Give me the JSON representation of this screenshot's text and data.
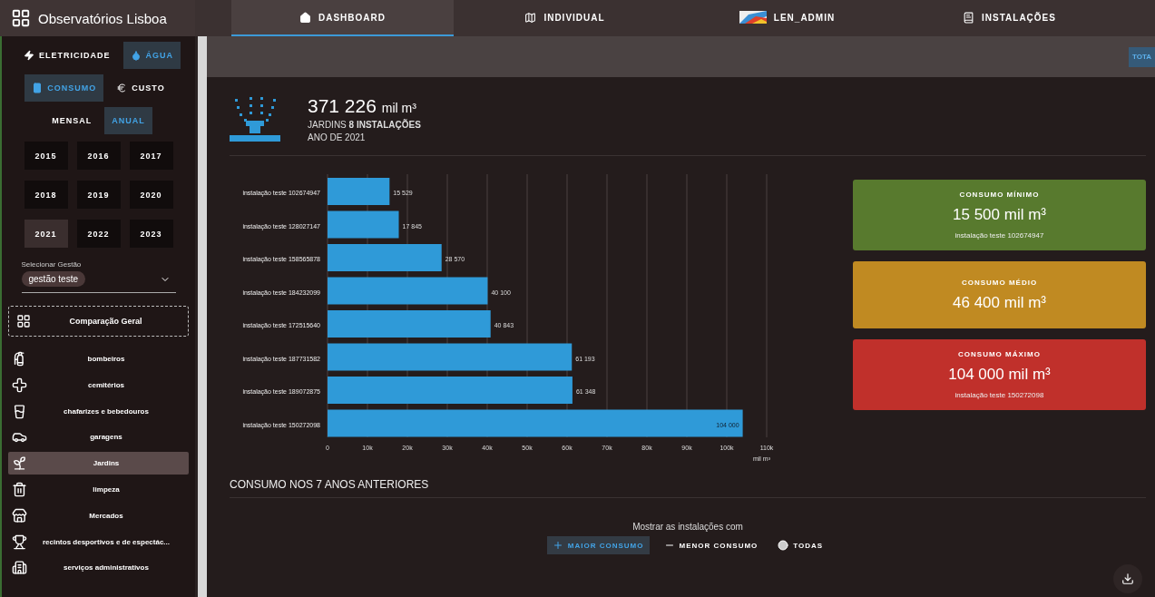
{
  "app": {
    "title": "Observatórios Lisboa"
  },
  "tabs": [
    {
      "label": "DASHBOARD",
      "selected": true
    },
    {
      "label": "INDIVIDUAL",
      "selected": false
    },
    {
      "label": "LEN_ADMIN",
      "selected": false
    },
    {
      "label": "INSTALAÇÕES",
      "selected": false
    }
  ],
  "toolbar": {
    "button": "TOTA"
  },
  "sidebar": {
    "toggles": [
      [
        {
          "label": "ELETRICIDADE",
          "selected": false
        },
        {
          "label": "ÁGUA",
          "selected": true
        }
      ],
      [
        {
          "label": "CONSUMO",
          "selected": true
        },
        {
          "label": "CUSTO",
          "selected": false
        }
      ],
      [
        {
          "label": "MENSAL",
          "selected": false
        },
        {
          "label": "ANUAL",
          "selected": true
        }
      ]
    ],
    "years": [
      {
        "label": "2015",
        "selected": false
      },
      {
        "label": "2016",
        "selected": false
      },
      {
        "label": "2017",
        "selected": false
      },
      {
        "label": "2018",
        "selected": false
      },
      {
        "label": "2019",
        "selected": false
      },
      {
        "label": "2020",
        "selected": false
      },
      {
        "label": "2021",
        "selected": true
      },
      {
        "label": "2022",
        "selected": false
      },
      {
        "label": "2023",
        "selected": false
      }
    ],
    "select": {
      "label": "Selecionar Gestão",
      "value": "gestão teste"
    },
    "overview": "Comparação Geral",
    "categories": [
      {
        "label": "bombeiros",
        "selected": false
      },
      {
        "label": "cemitérios",
        "selected": false
      },
      {
        "label": "chafarizes e bebedouros",
        "selected": false
      },
      {
        "label": "garagens",
        "selected": false
      },
      {
        "label": "Jardins",
        "selected": true
      },
      {
        "label": "limpeza",
        "selected": false
      },
      {
        "label": "Mercados",
        "selected": false
      },
      {
        "label": "recintos desportivos e de espectác...",
        "selected": false
      },
      {
        "label": "serviços administrativos",
        "selected": false
      }
    ]
  },
  "summary": {
    "total": "371 226",
    "unit": "mil m³",
    "subtitle": "JARDINS **8 INSTALAÇÕES**",
    "year": "ANO DE 2021"
  },
  "chart_data": {
    "type": "bar",
    "orientation": "horizontal",
    "xlabel": "mil m³",
    "categories": [
      "instalação teste 102674947",
      "instalação teste 128027147",
      "instalação teste 158565878",
      "instalação teste 184232099",
      "instalação teste 172515640",
      "instalação teste 187731582",
      "instalação teste 189072875",
      "instalação teste 150272098"
    ],
    "values": [
      15529,
      17845,
      28570,
      40100,
      40843,
      61193,
      61348,
      104000
    ],
    "grid": true,
    "value_labels": [
      "15 529",
      "17 845",
      "28 570",
      "40 100",
      "40 843",
      "61 193",
      "61 348",
      "104 000"
    ],
    "xlim": [
      0,
      110000
    ],
    "xticks": [
      {
        "value": 0,
        "label": "0"
      },
      {
        "value": 10000,
        "label": "10k"
      },
      {
        "value": 20000,
        "label": "20k"
      },
      {
        "value": 30000,
        "label": "30k"
      },
      {
        "value": 40000,
        "label": "40k"
      },
      {
        "value": 50000,
        "label": "50k"
      },
      {
        "value": 60000,
        "label": "60k"
      },
      {
        "value": 70000,
        "label": "70k"
      },
      {
        "value": 80000,
        "label": "80k"
      },
      {
        "value": 90000,
        "label": "90k"
      },
      {
        "value": 100000,
        "label": "100k"
      },
      {
        "value": 110000,
        "label": "110k"
      }
    ]
  },
  "cards": [
    {
      "title": "CONSUMO MÍNIMO",
      "value": "15 500 mil m³",
      "detail": "instalação teste 102674947",
      "color": "#587a2e"
    },
    {
      "title": "CONSUMO MÉDIO",
      "value": "46 400 mil m³",
      "color": "#c08a22"
    },
    {
      "title": "CONSUMO MÁXIMO",
      "value": "104 000 mil m³",
      "detail": "instalação teste 150272098",
      "color": "#c0302b"
    }
  ],
  "history": {
    "title": "CONSUMO NOS 7 ANOS ANTERIORES",
    "prompt": "Mostrar as instalações com",
    "filters": [
      {
        "label": "MAIOR CONSUMO",
        "selected": true
      },
      {
        "label": "MENOR CONSUMO",
        "selected": false
      },
      {
        "label": "TODAS",
        "selected": false
      }
    ]
  }
}
